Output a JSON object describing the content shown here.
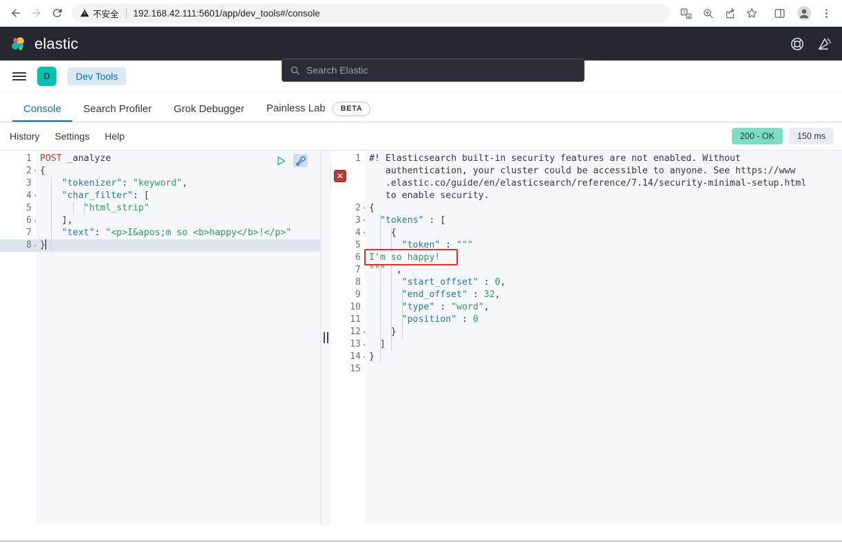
{
  "browser": {
    "back_icon": "arrow-left-icon",
    "forward_icon": "arrow-right-icon",
    "reload_icon": "reload-icon",
    "security_label": "不安全",
    "security_icon": "warning-triangle-icon",
    "url": "192.168.42.111:5601/app/dev_tools#/console",
    "toolbar_icons": [
      "translate-icon",
      "zoom-icon",
      "share-icon",
      "bookmark-star-icon",
      "side-panel-icon",
      "profile-avatar-icon",
      "more-menu-icon"
    ]
  },
  "header": {
    "brand": "elastic",
    "logo_icon": "elastic-logo-icon",
    "search": {
      "icon": "search-icon",
      "placeholder": "Search Elastic",
      "value": ""
    },
    "actions": [
      {
        "name": "help-icon",
        "label": ""
      },
      {
        "name": "news-feed-icon",
        "label": ""
      }
    ]
  },
  "nav": {
    "menu_icon": "hamburger-menu-icon",
    "space_initial": "D",
    "breadcrumb": "Dev Tools"
  },
  "tabs": [
    {
      "label": "Console",
      "active": true
    },
    {
      "label": "Search Profiler",
      "active": false
    },
    {
      "label": "Grok Debugger",
      "active": false
    },
    {
      "label": "Painless Lab",
      "active": false,
      "badge": "BETA"
    }
  ],
  "console_actions": {
    "links": [
      "History",
      "Settings",
      "Help"
    ],
    "status_code": "200 - OK",
    "duration": "150 ms",
    "status_color": "#7dddc3"
  },
  "request_editor": {
    "play_icon": "play-triangle-icon",
    "wrench_icon": "wrench-icon",
    "active_line": 8,
    "lines": [
      {
        "n": 1,
        "fold": "",
        "text": "POST _analyze",
        "tokens": [
          {
            "t": "POST",
            "c": "k-method"
          },
          {
            "t": " _analyze",
            "c": "k-path"
          }
        ]
      },
      {
        "n": 2,
        "fold": "▾",
        "text": "{",
        "tokens": [
          {
            "t": "{",
            "c": "k-punct"
          }
        ]
      },
      {
        "n": 3,
        "fold": "",
        "text": "    \"tokenizer\": \"keyword\",",
        "tokens": [
          {
            "t": "    ",
            "c": "k-punct"
          },
          {
            "t": "\"tokenizer\"",
            "c": "k-key"
          },
          {
            "t": ": ",
            "c": "k-punct"
          },
          {
            "t": "\"keyword\"",
            "c": "k-str"
          },
          {
            "t": ",",
            "c": "k-punct"
          }
        ]
      },
      {
        "n": 4,
        "fold": "▾",
        "text": "    \"char_filter\": [",
        "tokens": [
          {
            "t": "    ",
            "c": "k-punct"
          },
          {
            "t": "\"char_filter\"",
            "c": "k-key"
          },
          {
            "t": ": [",
            "c": "k-punct"
          }
        ]
      },
      {
        "n": 5,
        "fold": "",
        "text": "        \"html_strip\"",
        "tokens": [
          {
            "t": "        ",
            "c": "k-punct"
          },
          {
            "t": "\"html_strip\"",
            "c": "k-str"
          }
        ]
      },
      {
        "n": 6,
        "fold": "▴",
        "text": "    ],",
        "tokens": [
          {
            "t": "    ],",
            "c": "k-punct"
          }
        ]
      },
      {
        "n": 7,
        "fold": "",
        "text": "    \"text\": \"<p>I&apos;m so <b>happy</b>!</p>\"",
        "tokens": [
          {
            "t": "    ",
            "c": "k-punct"
          },
          {
            "t": "\"text\"",
            "c": "k-key"
          },
          {
            "t": ": ",
            "c": "k-punct"
          },
          {
            "t": "\"<p>I&apos;m so <b>happy</b>!</p>\"",
            "c": "k-str"
          }
        ]
      },
      {
        "n": 8,
        "fold": "▴",
        "text": "}",
        "tokens": [
          {
            "t": "}",
            "c": "k-punct"
          }
        ]
      }
    ]
  },
  "response_editor": {
    "error_marker_icon": "error-x-icon",
    "highlight": {
      "line": 6,
      "text": "I'm so happy!",
      "color": "#ee2724"
    },
    "lines": [
      {
        "n": 1,
        "fold": "",
        "tokens": [
          {
            "t": "#! Elasticsearch built-in security features are not enabled. Without",
            "c": "k-warn"
          }
        ]
      },
      {
        "n": "",
        "fold": "",
        "tokens": [
          {
            "t": "   authentication, your cluster could be accessible to anyone. See https://www",
            "c": "k-warn"
          }
        ]
      },
      {
        "n": "",
        "fold": "",
        "tokens": [
          {
            "t": "   .elastic.co/guide/en/elasticsearch/reference/7.14/security-minimal-setup.html",
            "c": "k-warn"
          }
        ]
      },
      {
        "n": "",
        "fold": "",
        "tokens": [
          {
            "t": "   to enable security.",
            "c": "k-warn"
          }
        ]
      },
      {
        "n": 2,
        "fold": "▾",
        "tokens": [
          {
            "t": "{",
            "c": "k-punct"
          }
        ]
      },
      {
        "n": 3,
        "fold": "▾",
        "tokens": [
          {
            "t": "  ",
            "c": "k-punct"
          },
          {
            "t": "\"tokens\"",
            "c": "k-key"
          },
          {
            "t": " : [",
            "c": "k-punct"
          }
        ]
      },
      {
        "n": 4,
        "fold": "▾",
        "tokens": [
          {
            "t": "    {",
            "c": "k-punct"
          }
        ]
      },
      {
        "n": 5,
        "fold": "",
        "tokens": [
          {
            "t": "      ",
            "c": "k-punct"
          },
          {
            "t": "\"token\"",
            "c": "k-key"
          },
          {
            "t": " : ",
            "c": "k-punct"
          },
          {
            "t": "\"\"\"",
            "c": "k-str"
          }
        ]
      },
      {
        "n": 6,
        "fold": "",
        "tokens": [
          {
            "t": "I'm so happy!",
            "c": "k-str"
          }
        ]
      },
      {
        "n": 7,
        "fold": "",
        "tokens": [
          {
            "t": "\"\"\"",
            "c": "k-str"
          },
          {
            "t": "  ,",
            "c": "k-punct"
          }
        ]
      },
      {
        "n": 8,
        "fold": "",
        "tokens": [
          {
            "t": "      ",
            "c": "k-punct"
          },
          {
            "t": "\"start_offset\"",
            "c": "k-key"
          },
          {
            "t": " : ",
            "c": "k-punct"
          },
          {
            "t": "0",
            "c": "k-num"
          },
          {
            "t": ",",
            "c": "k-punct"
          }
        ]
      },
      {
        "n": 9,
        "fold": "",
        "tokens": [
          {
            "t": "      ",
            "c": "k-punct"
          },
          {
            "t": "\"end_offset\"",
            "c": "k-key"
          },
          {
            "t": " : ",
            "c": "k-punct"
          },
          {
            "t": "32",
            "c": "k-num"
          },
          {
            "t": ",",
            "c": "k-punct"
          }
        ]
      },
      {
        "n": 10,
        "fold": "",
        "tokens": [
          {
            "t": "      ",
            "c": "k-punct"
          },
          {
            "t": "\"type\"",
            "c": "k-key"
          },
          {
            "t": " : ",
            "c": "k-punct"
          },
          {
            "t": "\"word\"",
            "c": "k-str"
          },
          {
            "t": ",",
            "c": "k-punct"
          }
        ]
      },
      {
        "n": 11,
        "fold": "",
        "tokens": [
          {
            "t": "      ",
            "c": "k-punct"
          },
          {
            "t": "\"position\"",
            "c": "k-key"
          },
          {
            "t": " : ",
            "c": "k-punct"
          },
          {
            "t": "0",
            "c": "k-num"
          }
        ]
      },
      {
        "n": 12,
        "fold": "▴",
        "tokens": [
          {
            "t": "    }",
            "c": "k-punct"
          }
        ]
      },
      {
        "n": 13,
        "fold": "▴",
        "tokens": [
          {
            "t": "  ]",
            "c": "k-punct"
          }
        ]
      },
      {
        "n": 14,
        "fold": "▴",
        "tokens": [
          {
            "t": "}",
            "c": "k-punct"
          }
        ]
      },
      {
        "n": 15,
        "fold": "",
        "tokens": []
      }
    ]
  },
  "splitter": {
    "handle_icon": "drag-handle-icon"
  }
}
